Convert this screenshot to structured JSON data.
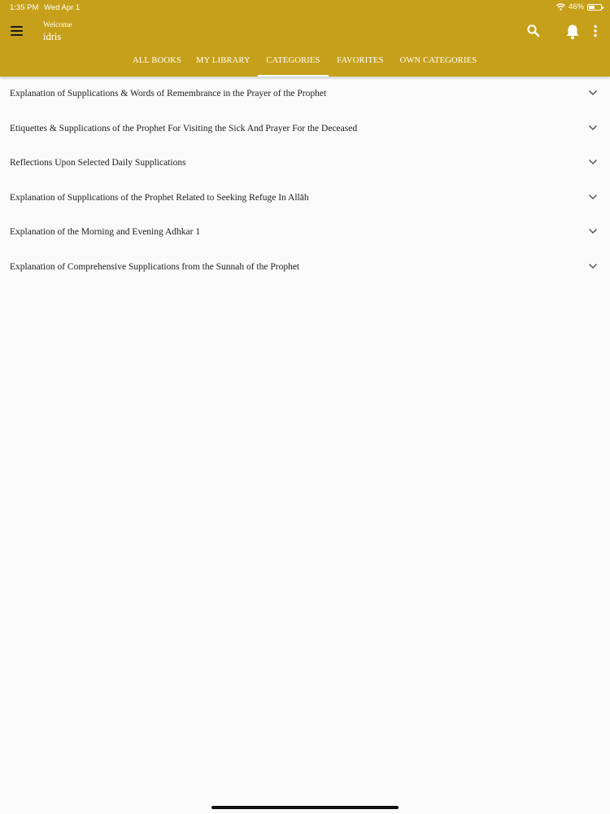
{
  "status_bar": {
    "time": "1:35 PM",
    "date": "Wed Apr 1",
    "battery": "46%"
  },
  "header": {
    "welcome": "Welcome",
    "username": "idris",
    "color": "#c6a01a"
  },
  "icons": {
    "menu": "hamburger-menu-icon",
    "search": "search-icon",
    "notifications": "bell-icon",
    "more": "more-vertical-icon",
    "expand": "chevron-down-icon"
  },
  "tabs": [
    {
      "label": "ALL BOOKS",
      "active": false
    },
    {
      "label": "MY LIBRARY",
      "active": false
    },
    {
      "label": "CATEGORIES",
      "active": true
    },
    {
      "label": "FAVORITES",
      "active": false
    },
    {
      "label": "OWN CATEGORIES",
      "active": false
    }
  ],
  "categories": [
    {
      "title": "Explanation of Supplications & Words of Remembrance in the Prayer of the Prophet"
    },
    {
      "title": "Etiquettes & Supplications of the Prophet For Visiting the Sick And Prayer For the Deceased"
    },
    {
      "title": "Reflections Upon Selected Daily Supplications"
    },
    {
      "title": "Explanation of Supplications of the Prophet Related to Seeking Refuge In Allāh"
    },
    {
      "title": "Explanation of the Morning and Evening Adhkar 1"
    },
    {
      "title": "Explanation of Comprehensive Supplications from the Sunnah of the Prophet"
    }
  ]
}
